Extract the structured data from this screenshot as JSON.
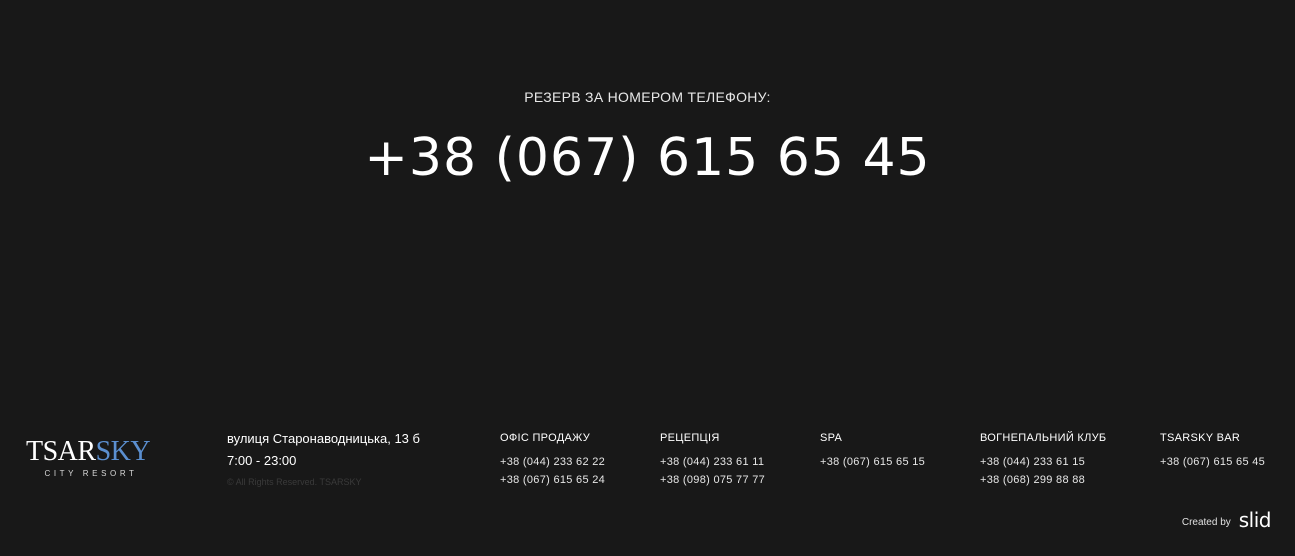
{
  "reserve": {
    "label": "РЕЗЕРВ ЗА НОМЕРОМ ТЕЛЕФОНУ:",
    "phone": "+38 (067) 615 65 45"
  },
  "logo": {
    "main_a": "TSAR",
    "main_b": "SKY",
    "sub": "CITY RESORT",
    "accent_color": "#5b8fd0"
  },
  "footer": {
    "address": "вулиця Старонаводницька, 13 б",
    "hours": "7:00 - 23:00",
    "copyright": "© All Rights Reserved. TSARSKY",
    "columns": [
      {
        "title": "ОФІС ПРОДАЖУ",
        "phones": [
          "+38 (044) 233 62 22",
          "+38 (067) 615 65 24"
        ]
      },
      {
        "title": "РЕЦЕПЦІЯ",
        "phones": [
          "+38 (044) 233 61 11",
          "+38 (098) 075 77 77"
        ]
      },
      {
        "title": "SPA",
        "phones": [
          "+38 (067) 615 65 15"
        ]
      },
      {
        "title": "ВОГНЕПАЛЬНИЙ КЛУБ",
        "phones": [
          "+38 (044) 233 61 15",
          "+38 (068) 299 88 88"
        ]
      },
      {
        "title": "TSARSKY BAR",
        "phones": [
          "+38 (067) 615 65 45"
        ]
      }
    ],
    "created_by_label": "Created by",
    "created_by_brand": "slid"
  },
  "colors": {
    "background": "#181818",
    "text": "#ffffff"
  }
}
